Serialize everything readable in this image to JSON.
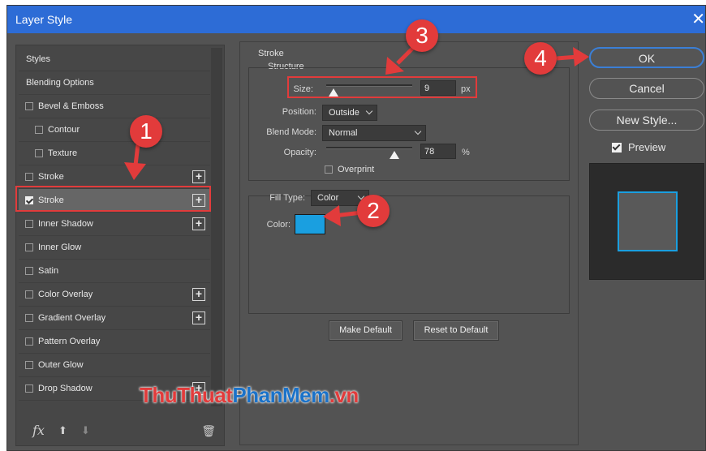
{
  "window": {
    "title": "Layer Style",
    "close_glyph": "✕"
  },
  "styles_panel": {
    "items": [
      {
        "label": "Styles",
        "type": "header"
      },
      {
        "label": "Blending Options",
        "type": "header"
      },
      {
        "label": "Bevel & Emboss",
        "checked": false
      },
      {
        "label": "Contour",
        "checked": false,
        "indent": true
      },
      {
        "label": "Texture",
        "checked": false,
        "indent": true
      },
      {
        "label": "Stroke",
        "checked": false,
        "plus": true
      },
      {
        "label": "Stroke",
        "checked": true,
        "plus": true,
        "selected": true
      },
      {
        "label": "Inner Shadow",
        "checked": false,
        "plus": true
      },
      {
        "label": "Inner Glow",
        "checked": false
      },
      {
        "label": "Satin",
        "checked": false
      },
      {
        "label": "Color Overlay",
        "checked": false,
        "plus": true
      },
      {
        "label": "Gradient Overlay",
        "checked": false,
        "plus": true
      },
      {
        "label": "Pattern Overlay",
        "checked": false
      },
      {
        "label": "Outer Glow",
        "checked": false
      },
      {
        "label": "Drop Shadow",
        "checked": false,
        "plus": true
      }
    ],
    "footer": {
      "fx": "fx",
      "up_glyph": "⬆",
      "down_glyph": "⬇",
      "trash_glyph": "🗑"
    }
  },
  "stroke": {
    "title": "Stroke",
    "structure_title": "Structure",
    "size": {
      "label": "Size:",
      "value": "9",
      "unit": "px"
    },
    "position": {
      "label": "Position:",
      "value": "Outside"
    },
    "blend_mode": {
      "label": "Blend Mode:",
      "value": "Normal"
    },
    "opacity": {
      "label": "Opacity:",
      "value": "78",
      "unit": "%"
    },
    "overprint": {
      "label": "Overprint",
      "checked": false
    },
    "fill_type": {
      "label": "Fill Type:",
      "value": "Color"
    },
    "color": {
      "label": "Color:",
      "value": "#1a9fe0"
    },
    "make_default": "Make Default",
    "reset_default": "Reset to Default"
  },
  "actions": {
    "ok": "OK",
    "cancel": "Cancel",
    "new_style": "New Style...",
    "preview_label": "Preview",
    "preview_checked": true
  },
  "annotations": {
    "badge1": "1",
    "badge2": "2",
    "badge3": "3",
    "badge4": "4"
  },
  "watermark": {
    "part1": "ThuThuat",
    "part2": "PhanMem",
    "part3": ".vn"
  },
  "colors": {
    "accent": "#e23b3b",
    "titlebar": "#2d6cd6",
    "stroke_color": "#1a9fe0"
  }
}
